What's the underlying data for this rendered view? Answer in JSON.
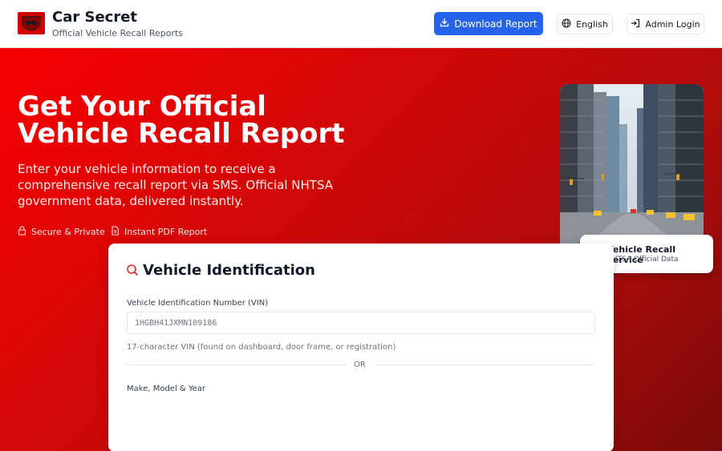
{
  "header": {
    "brand_title": "Car Secret",
    "brand_subtitle": "Official Vehicle Recall Reports",
    "download_label": "Download Report",
    "language_label": "English",
    "admin_label": "Admin Login"
  },
  "hero": {
    "title": "Get Your Official Vehicle Recall Report",
    "description": "Enter your vehicle information to receive a comprehensive recall report via SMS. Official NHTSA government data, delivered instantly.",
    "features": [
      "Secure & Private",
      "Instant PDF Report"
    ]
  },
  "service_card": {
    "title": "Vehicle Recall Service",
    "subtitle": "NHTSA Official Data"
  },
  "form": {
    "title": "Vehicle Identification",
    "vin_label": "Vehicle Identification Number (VIN)",
    "vin_placeholder": "1HGBH41JXMN109186",
    "vin_help": "17-character VIN (found on dashboard, door frame, or registration)",
    "or_text": "OR",
    "mmy_label": "Make, Model & Year"
  },
  "colors": {
    "accent": "#2563eb",
    "brand_red": "#d10000"
  }
}
